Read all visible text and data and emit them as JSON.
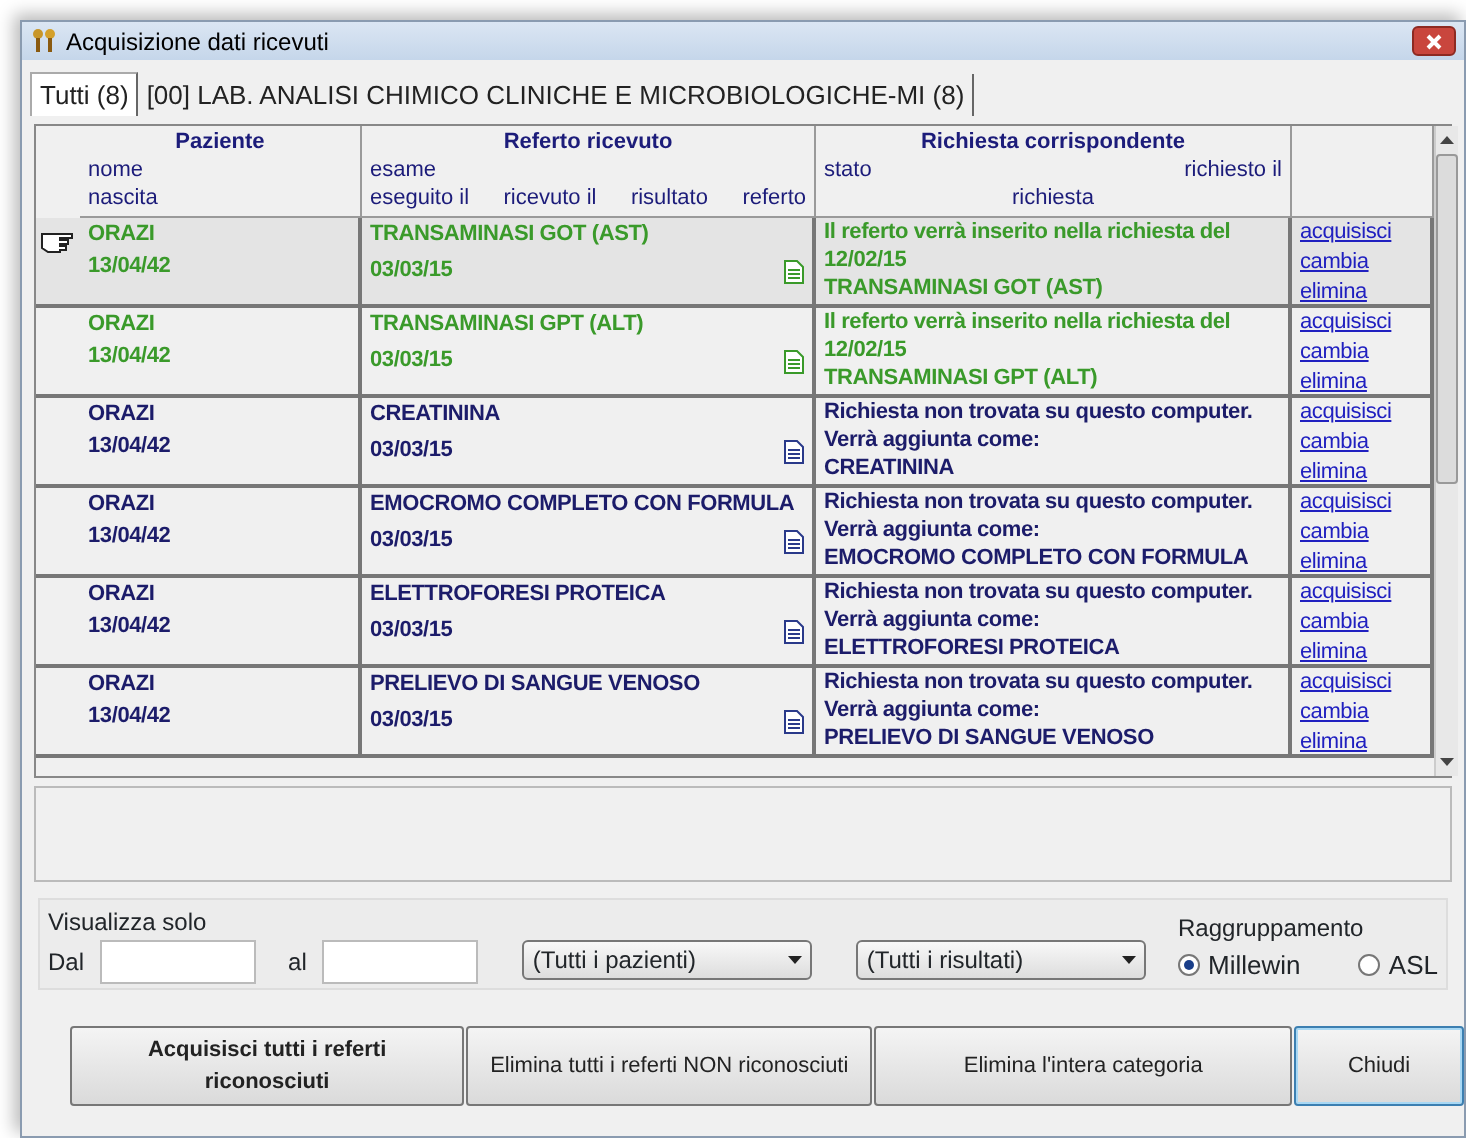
{
  "window": {
    "title": "Acquisizione dati ricevuti"
  },
  "tabs": [
    {
      "label": "Tutti (8)",
      "selected": true
    },
    {
      "label": "[00] LAB. ANALISI CHIMICO CLINICHE E MICROBIOLOGICHE-MI (8)",
      "selected": false
    }
  ],
  "table": {
    "groups": [
      "Paziente",
      "Referto ricevuto",
      "Richiesta corrispondente"
    ],
    "subheaders": {
      "nome": "nome",
      "nascita": "nascita",
      "esame": "esame",
      "eseguito": "eseguito il",
      "ricevuto": "ricevuto il",
      "risultato": "risultato",
      "referto": "referto",
      "stato": "stato",
      "richiesto": "richiesto il",
      "richiesta": "richiesta"
    },
    "rows": [
      {
        "kind": "matched",
        "current": true,
        "nome": "ORAZI",
        "nascita": "13/04/42",
        "esame": "TRANSAMINASI GOT (AST)",
        "eseguito": "03/03/15",
        "stato": [
          "Il referto verrà inserito nella richiesta del",
          "12/02/15"
        ],
        "richiesta": "TRANSAMINASI GOT (AST)",
        "actions": [
          "acquisisci",
          "cambia",
          "elimina"
        ]
      },
      {
        "kind": "matched",
        "current": false,
        "nome": "ORAZI",
        "nascita": "13/04/42",
        "esame": "TRANSAMINASI GPT (ALT)",
        "eseguito": "03/03/15",
        "stato": [
          "Il referto verrà inserito nella richiesta del",
          "12/02/15"
        ],
        "richiesta": "TRANSAMINASI GPT (ALT)",
        "actions": [
          "acquisisci",
          "cambia",
          "elimina"
        ]
      },
      {
        "kind": "new",
        "current": false,
        "nome": "ORAZI",
        "nascita": "13/04/42",
        "esame": "CREATININA",
        "eseguito": "03/03/15",
        "stato": [
          "Richiesta non trovata su questo computer.",
          "Verrà aggiunta come:"
        ],
        "richiesta": "CREATININA",
        "actions": [
          "acquisisci",
          "cambia",
          "elimina"
        ]
      },
      {
        "kind": "new",
        "current": false,
        "nome": "ORAZI",
        "nascita": "13/04/42",
        "esame": "EMOCROMO COMPLETO CON FORMULA",
        "eseguito": "03/03/15",
        "stato": [
          "Richiesta non trovata su questo computer.",
          "Verrà aggiunta come:"
        ],
        "richiesta": "EMOCROMO COMPLETO CON FORMULA",
        "actions": [
          "acquisisci",
          "cambia",
          "elimina"
        ]
      },
      {
        "kind": "new",
        "current": false,
        "nome": "ORAZI",
        "nascita": "13/04/42",
        "esame": "ELETTROFORESI PROTEICA",
        "eseguito": "03/03/15",
        "stato": [
          "Richiesta non trovata su questo computer.",
          "Verrà aggiunta come:"
        ],
        "richiesta": "ELETTROFORESI PROTEICA",
        "actions": [
          "acquisisci",
          "cambia",
          "elimina"
        ]
      },
      {
        "kind": "new",
        "current": false,
        "nome": "ORAZI",
        "nascita": "13/04/42",
        "esame": "PRELIEVO DI SANGUE VENOSO",
        "eseguito": "03/03/15",
        "stato": [
          "Richiesta non trovata su questo computer.",
          "Verrà aggiunta come:"
        ],
        "richiesta": "PRELIEVO DI SANGUE VENOSO",
        "actions": [
          "acquisisci",
          "cambia",
          "elimina"
        ]
      }
    ]
  },
  "filter": {
    "title": "Visualizza solo",
    "dal_label": "Dal",
    "al_label": "al",
    "patients": "(Tutti i pazienti)",
    "results": "(Tutti i risultati)"
  },
  "grouping": {
    "title": "Raggruppamento",
    "options": [
      {
        "label": "Millewin",
        "selected": true
      },
      {
        "label": "ASL",
        "selected": false
      }
    ]
  },
  "buttons": [
    {
      "label": "Acquisisci tutti i referti riconosciuti",
      "bold": true,
      "focused": false
    },
    {
      "label": "Elimina tutti i referti NON riconosciuti",
      "bold": false,
      "focused": false
    },
    {
      "label": "Elimina l'intera categoria",
      "bold": false,
      "focused": false
    },
    {
      "label": "Chiudi",
      "bold": false,
      "focused": true
    }
  ]
}
